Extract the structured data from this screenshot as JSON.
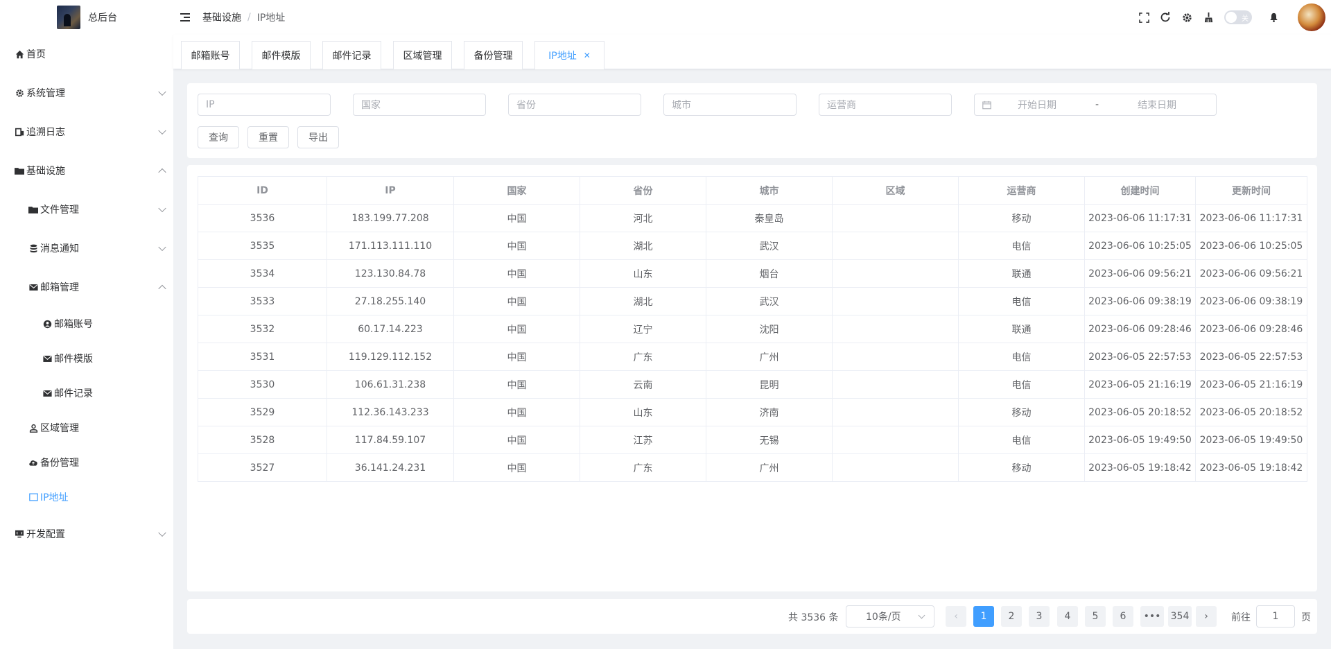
{
  "app": {
    "title": "总后台"
  },
  "sidebar": {
    "items": [
      {
        "label": "首页",
        "icon": "home-icon"
      },
      {
        "label": "系统管理",
        "icon": "gear-icon"
      },
      {
        "label": "追溯日志",
        "icon": "log-icon"
      },
      {
        "label": "基础设施",
        "icon": "folder-icon"
      },
      {
        "label": "文件管理",
        "icon": "folder-icon"
      },
      {
        "label": "消息通知",
        "icon": "database-icon"
      },
      {
        "label": "邮箱管理",
        "icon": "mail-icon"
      },
      {
        "label": "邮箱账号",
        "icon": "account-icon"
      },
      {
        "label": "邮件模版",
        "icon": "mail-icon"
      },
      {
        "label": "邮件记录",
        "icon": "mail-icon"
      },
      {
        "label": "区域管理",
        "icon": "user-icon"
      },
      {
        "label": "备份管理",
        "icon": "cloud-upload-icon"
      },
      {
        "label": "IP地址",
        "icon": "monitor-icon"
      },
      {
        "label": "开发配置",
        "icon": "dev-icon"
      }
    ]
  },
  "header": {
    "breadcrumb": [
      "基础设施",
      "IP地址"
    ],
    "switch_label": "关"
  },
  "tags": [
    "邮箱账号",
    "邮件模版",
    "邮件记录",
    "区域管理",
    "备份管理",
    "IP地址"
  ],
  "search": {
    "ip_placeholder": "IP",
    "country_placeholder": "国家",
    "province_placeholder": "省份",
    "city_placeholder": "城市",
    "isp_placeholder": "运营商",
    "start_date_placeholder": "开始日期",
    "date_sep": "-",
    "end_date_placeholder": "结束日期",
    "query_label": "查询",
    "reset_label": "重置",
    "export_label": "导出"
  },
  "table": {
    "columns": [
      "ID",
      "IP",
      "国家",
      "省份",
      "城市",
      "区域",
      "运营商",
      "创建时间",
      "更新时间"
    ],
    "rows": [
      [
        "3536",
        "183.199.77.208",
        "中国",
        "河北",
        "秦皇岛",
        "",
        "移动",
        "2023-06-06 11:17:31",
        "2023-06-06 11:17:31"
      ],
      [
        "3535",
        "171.113.111.110",
        "中国",
        "湖北",
        "武汉",
        "",
        "电信",
        "2023-06-06 10:25:05",
        "2023-06-06 10:25:05"
      ],
      [
        "3534",
        "123.130.84.78",
        "中国",
        "山东",
        "烟台",
        "",
        "联通",
        "2023-06-06 09:56:21",
        "2023-06-06 09:56:21"
      ],
      [
        "3533",
        "27.18.255.140",
        "中国",
        "湖北",
        "武汉",
        "",
        "电信",
        "2023-06-06 09:38:19",
        "2023-06-06 09:38:19"
      ],
      [
        "3532",
        "60.17.14.223",
        "中国",
        "辽宁",
        "沈阳",
        "",
        "联通",
        "2023-06-06 09:28:46",
        "2023-06-06 09:28:46"
      ],
      [
        "3531",
        "119.129.112.152",
        "中国",
        "广东",
        "广州",
        "",
        "电信",
        "2023-06-05 22:57:53",
        "2023-06-05 22:57:53"
      ],
      [
        "3530",
        "106.61.31.238",
        "中国",
        "云南",
        "昆明",
        "",
        "电信",
        "2023-06-05 21:16:19",
        "2023-06-05 21:16:19"
      ],
      [
        "3529",
        "112.36.143.233",
        "中国",
        "山东",
        "济南",
        "",
        "移动",
        "2023-06-05 20:18:52",
        "2023-06-05 20:18:52"
      ],
      [
        "3528",
        "117.84.59.107",
        "中国",
        "江苏",
        "无锡",
        "",
        "电信",
        "2023-06-05 19:49:50",
        "2023-06-05 19:49:50"
      ],
      [
        "3527",
        "36.141.24.231",
        "中国",
        "广东",
        "广州",
        "",
        "移动",
        "2023-06-05 19:18:42",
        "2023-06-05 19:18:42"
      ]
    ]
  },
  "pagination": {
    "total_text": "共 3536 条",
    "page_size": "10条/页",
    "pages": [
      "1",
      "2",
      "3",
      "4",
      "5",
      "6",
      "•••",
      "354"
    ],
    "current_page": "1",
    "goto_prefix": "前往",
    "goto_value": "1",
    "goto_suffix": "页"
  },
  "colors": {
    "accent": "#409eff",
    "border": "#ebeef5",
    "background": "#f0f2f5"
  }
}
